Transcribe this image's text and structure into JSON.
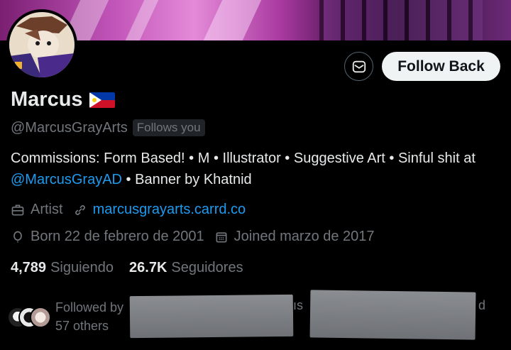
{
  "profile": {
    "display_name": "Marcus",
    "flag_icon": "philippines-flag-icon",
    "handle": "@MarcusGrayArts",
    "follows_you_badge": "Follows you"
  },
  "actions": {
    "message_icon": "envelope-icon",
    "follow_back_label": "Follow Back"
  },
  "bio": {
    "part1": "Commissions: Form Based! • M • Illustrator • Suggestive Art • Sinful shit at ",
    "mention": "@MarcusGrayAD",
    "part2": " • Banner by Khatnid"
  },
  "meta": {
    "category_icon": "briefcase-icon",
    "category": "Artist",
    "website_icon": "link-icon",
    "website": "marcusgrayarts.carrd.co",
    "birthday_icon": "balloon-icon",
    "birthday": "Born 22 de febrero de 2001",
    "joined_icon": "calendar-icon",
    "joined": "Joined marzo de 2017"
  },
  "stats": {
    "following_count": "4,789",
    "following_label": "Siguiendo",
    "followers_count": "26.7K",
    "followers_label": "Seguidores"
  },
  "followed_by": {
    "line1": "Followed by",
    "line2": "57 others",
    "stray_fragment_1": "ıs",
    "stray_fragment_2": "d"
  },
  "colors": {
    "background": "#000000",
    "text_primary": "#e7e9ea",
    "text_secondary": "#71767b",
    "link": "#1d9bf0",
    "button_bg": "#eff3f4"
  }
}
